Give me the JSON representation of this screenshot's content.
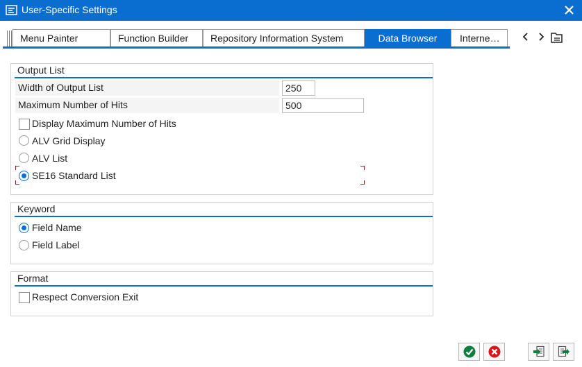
{
  "window": {
    "title": "User-Specific Settings",
    "title_icon": "settings-window-icon",
    "close_icon": "close-icon"
  },
  "tabs": [
    {
      "label": "Menu Painter",
      "active": false
    },
    {
      "label": "Function Builder",
      "active": false
    },
    {
      "label": "Repository Information System",
      "active": false
    },
    {
      "label": "Data Browser",
      "active": true
    },
    {
      "label": "Interne…",
      "active": false
    }
  ],
  "tab_controls": {
    "prev_icon": "chevron-left-icon",
    "next_icon": "chevron-right-icon",
    "list_icon": "tab-list-icon"
  },
  "output_list": {
    "title": "Output List",
    "width_label": "Width of Output List",
    "width_value": "250",
    "max_hits_label": "Maximum Number of Hits",
    "max_hits_value": "500",
    "display_max_label": "Display Maximum Number of Hits",
    "display_max_checked": false,
    "options": [
      {
        "label": "ALV Grid Display",
        "selected": false
      },
      {
        "label": "ALV List",
        "selected": false
      },
      {
        "label": "SE16 Standard List",
        "selected": true
      }
    ]
  },
  "keyword": {
    "title": "Keyword",
    "options": [
      {
        "label": "Field Name",
        "selected": true
      },
      {
        "label": "Field Label",
        "selected": false
      }
    ]
  },
  "format": {
    "title": "Format",
    "respect_conversion_label": "Respect Conversion Exit",
    "respect_conversion_checked": false
  },
  "footer": {
    "confirm_icon": "check-icon",
    "cancel_icon": "cancel-icon",
    "import_icon": "import-icon",
    "export_icon": "export-icon"
  },
  "colors": {
    "accent": "#0a6ed1",
    "confirm": "#107e3e",
    "cancel": "#d81818",
    "focus": "#9b1c1c"
  }
}
